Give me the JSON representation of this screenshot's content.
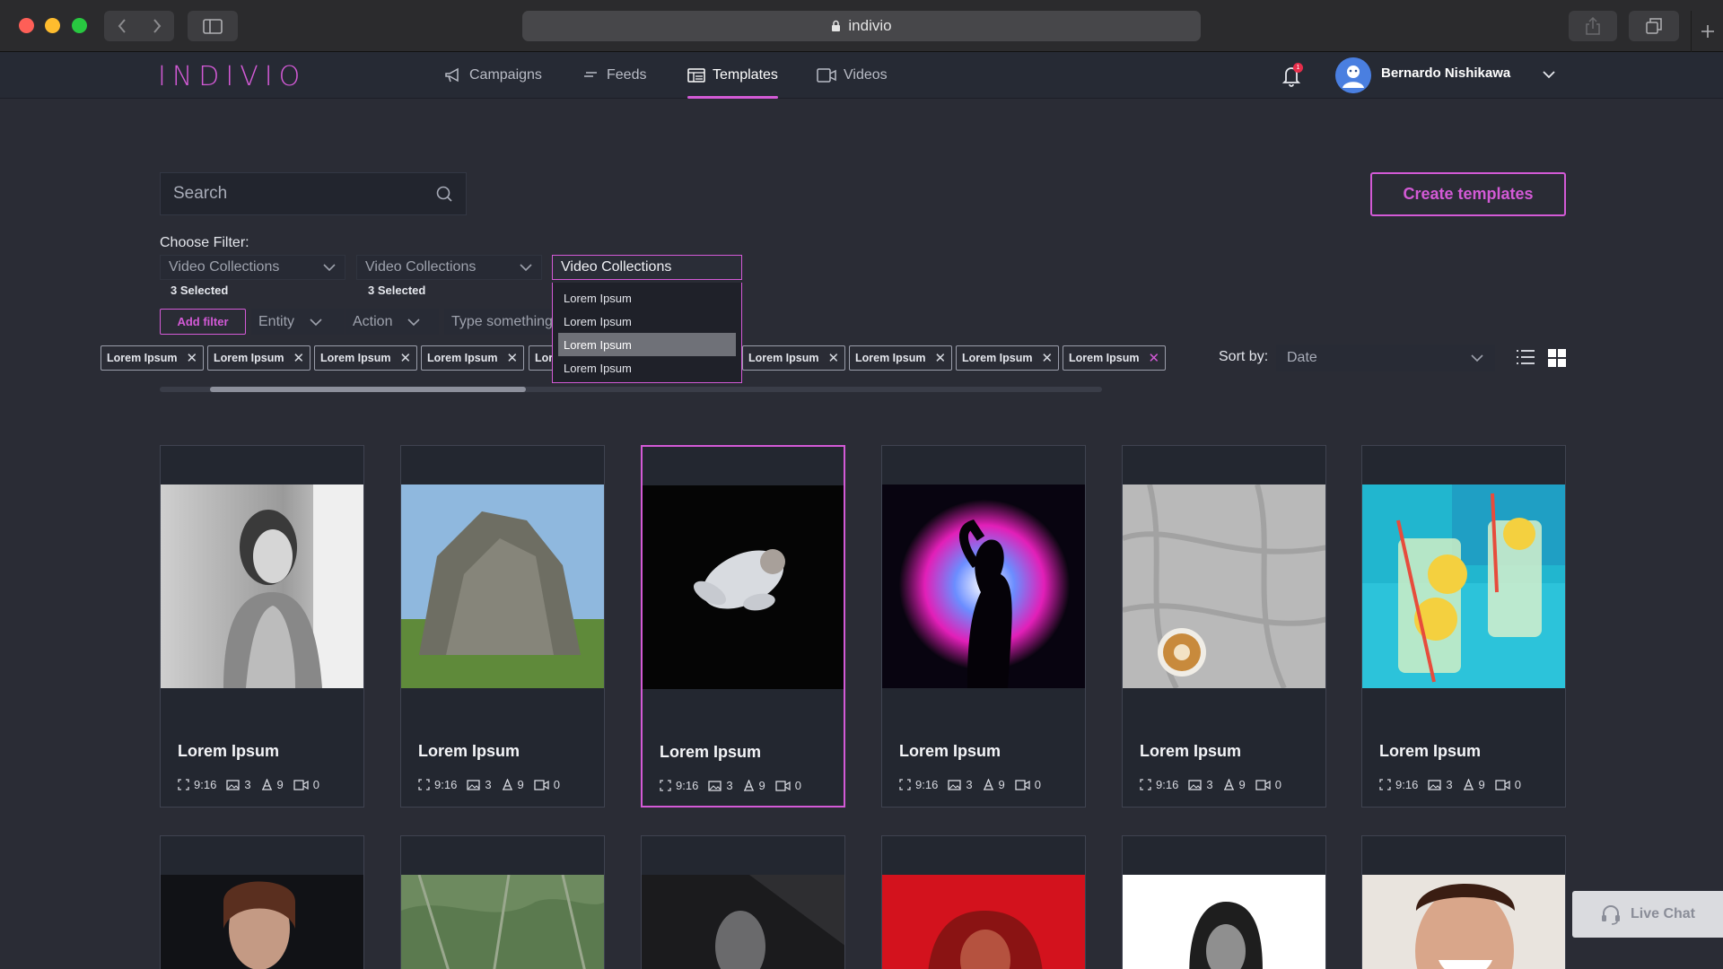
{
  "browser": {
    "url": "indivio"
  },
  "nav": {
    "logo": "INDIVIO",
    "items": [
      {
        "label": "Campaigns",
        "icon": "megaphone-icon"
      },
      {
        "label": "Feeds",
        "icon": "feed-icon"
      },
      {
        "label": "Templates",
        "icon": "templates-icon",
        "active": true
      },
      {
        "label": "Videos",
        "icon": "video-icon"
      }
    ],
    "notification_count": "1",
    "user_name": "Bernardo Nishikawa"
  },
  "search": {
    "placeholder": "Search"
  },
  "create_button": "Create templates",
  "filters": {
    "label": "Choose Filter:",
    "selects": [
      {
        "value": "Video Collections",
        "note": "3 Selected"
      },
      {
        "value": "Video Collections",
        "note": "3 Selected"
      },
      {
        "value": "Video Collections"
      }
    ],
    "dropdown_options": [
      "Lorem Ipsum",
      "Lorem Ipsum",
      "Lorem Ipsum",
      "Lorem Ipsum"
    ],
    "dropdown_highlighted_index": 2,
    "add_filter": "Add filter",
    "entity": "Entity",
    "action": "Action",
    "type_placeholder": "Type something",
    "chips": [
      "Lorem Ipsum",
      "Lorem Ipsum",
      "Lorem Ipsum",
      "Lorem Ipsum",
      "Lor",
      "Lorem Ipsum",
      "Lorem Ipsum",
      "Lorem Ipsum",
      "Lorem Ipsum"
    ]
  },
  "sort": {
    "label": "Sort by:",
    "value": "Date"
  },
  "cards": [
    {
      "title": "Lorem Ipsum",
      "ratio": "9:16",
      "images": "3",
      "texts": "9",
      "videos": "0"
    },
    {
      "title": "Lorem Ipsum",
      "ratio": "9:16",
      "images": "3",
      "texts": "9",
      "videos": "0"
    },
    {
      "title": "Lorem Ipsum",
      "ratio": "9:16",
      "images": "3",
      "texts": "9",
      "videos": "0",
      "selected": true
    },
    {
      "title": "Lorem Ipsum",
      "ratio": "9:16",
      "images": "3",
      "texts": "9",
      "videos": "0"
    },
    {
      "title": "Lorem Ipsum",
      "ratio": "9:16",
      "images": "3",
      "texts": "9",
      "videos": "0"
    },
    {
      "title": "Lorem Ipsum",
      "ratio": "9:16",
      "images": "3",
      "texts": "9",
      "videos": "0"
    }
  ],
  "live_chat": "Live Chat",
  "colors": {
    "accent": "#d35ad6",
    "background": "#2a2c35",
    "card": "#232730"
  }
}
